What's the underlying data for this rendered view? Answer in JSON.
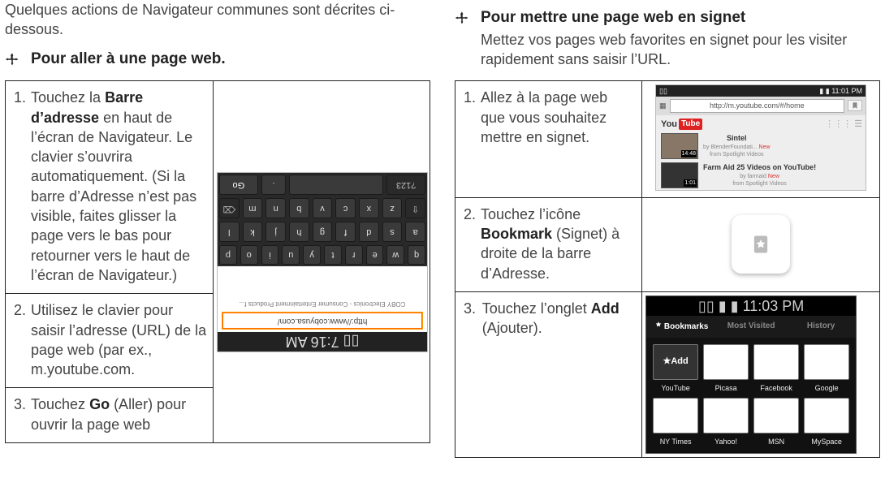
{
  "left": {
    "intro": "Quelques actions de Navigateur communes sont décrites ci-dessous.",
    "heading": "Pour aller à une page web.",
    "steps": {
      "s1_pre": "Touchez la ",
      "s1_b": "Barre d’adresse",
      "s1_post": " en haut de l’écran de Navigateur. Le clavier s’ouvrira automatiquement. (Si la barre d’Adresse n’est pas visible, faites glisser la page vers le bas pour retourner vers le haut de l’écran de Navigateur.)",
      "s2": "Utilisez le clavier pour saisir l’adresse (URL) de la page web (par ex., m.youtube.com.",
      "s3_pre": "Touchez ",
      "s3_b": "Go",
      "s3_post": " (Aller) pour ouvrir la page web"
    },
    "shot": {
      "time": "7:16 AM",
      "url": "http://www.cobyusa.com/",
      "caption": "COBY Electronics - Consumer Entertainment Products f...",
      "keys_r1": [
        "q",
        "w",
        "e",
        "r",
        "t",
        "y",
        "u",
        "i",
        "o",
        "p"
      ],
      "keys_r2": [
        "a",
        "s",
        "d",
        "f",
        "g",
        "h",
        "j",
        "k",
        "l"
      ],
      "keys_r3": [
        "⇧",
        "z",
        "x",
        "c",
        "v",
        "b",
        "n",
        "m",
        "⌫"
      ],
      "keys_r4_a": "?123",
      "keys_r4_b": "space",
      "keys_r4_c": ".",
      "keys_r4_d": "Go"
    }
  },
  "right": {
    "heading": "Pour mettre une page web en signet",
    "sub": "Mettez vos pages web favorites en signet pour les visiter rapidement sans saisir l’URL.",
    "steps": {
      "s1": "Allez à la page web que vous souhaitez mettre en signet.",
      "s2_pre": "Touchez l’icône ",
      "s2_b": "Bookmark",
      "s2_post": " (Signet) à droite de la barre d’Adresse.",
      "s3_pre": "Touchez l’onglet ",
      "s3_b": "Add",
      "s3_post": " (Ajouter)."
    },
    "yt": {
      "time": "11:01 PM",
      "url": "http://m.youtube.com/#/home",
      "brand_a": "You",
      "brand_b": "Tube",
      "v1_title": "Sintel",
      "v1_sub": "by BlenderFoundati...",
      "v1_from": "from Spotlight Videos",
      "v1_dur": "14:48",
      "v2_title": "Farm Aid 25 Videos on YouTube!",
      "v2_sub": "by farmaid",
      "v2_from": "from Spotlight Videos",
      "v2_dur": "1:01",
      "new": "New"
    },
    "bm": {
      "time": "11:03 PM",
      "tab1": "Bookmarks",
      "tab2": "Most Visited",
      "tab3": "History",
      "add": "Add",
      "cells": [
        "YouTube",
        "Picasa",
        "Facebook",
        "Google",
        "NY Times",
        "Yahoo!",
        "MSN",
        "MySpace"
      ]
    }
  },
  "nums": {
    "n1": "1.",
    "n2": "2.",
    "n3": "3."
  }
}
